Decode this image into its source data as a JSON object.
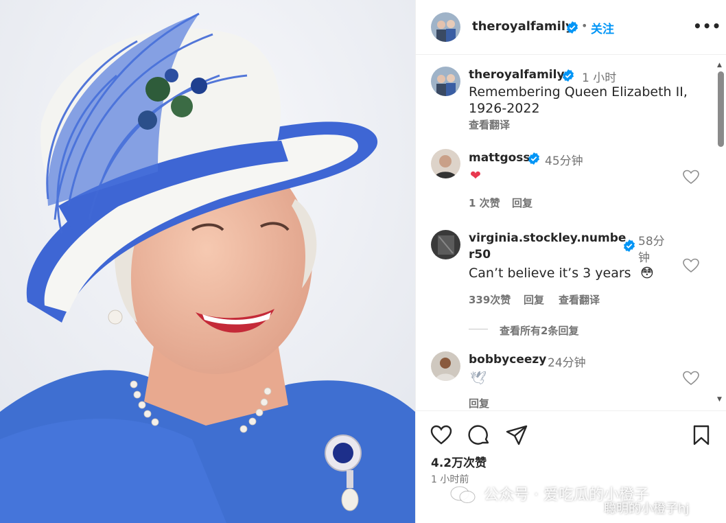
{
  "post": {
    "username": "theroyalfamily",
    "follow_label": "关注",
    "dot": "•",
    "more": "•••",
    "caption_user": "theroyalfamily",
    "caption_time": "1 小时",
    "caption_line1": "Remembering Queen Elizabeth II,",
    "caption_line2": "1926-2022",
    "translate_label": "查看翻译",
    "likes": "4.2万次赞",
    "posted_time": "1 小时前"
  },
  "comments": [
    {
      "user": "mattgoss",
      "time": "45分钟",
      "text": "❤",
      "likes": "1 次赞",
      "reply": "回复"
    },
    {
      "user_line1": "virginia.stockley.numbe",
      "user_line2": "r50",
      "time_line1": "58分",
      "time_line2": "钟",
      "text": "Can’t believe it’s 3 years",
      "emoji": "😳",
      "likes": "339次赞",
      "reply": "回复",
      "translate": "查看翻译"
    },
    {
      "view_replies": "查看所有2条回复"
    },
    {
      "user": "bobbyceezy",
      "time": "24分钟",
      "text": "🕊",
      "reply": "回复"
    }
  ],
  "watermark": {
    "text": "公众号 · 爱吃瓜的小橙子",
    "text2": "聪明的小橙子hj"
  },
  "colors": {
    "link": "#0095f6",
    "verified": "#0095f6",
    "secondary": "#737373"
  },
  "icons": [
    "verified-icon",
    "more-icon",
    "heart-icon",
    "comment-icon",
    "share-icon",
    "save-icon"
  ]
}
